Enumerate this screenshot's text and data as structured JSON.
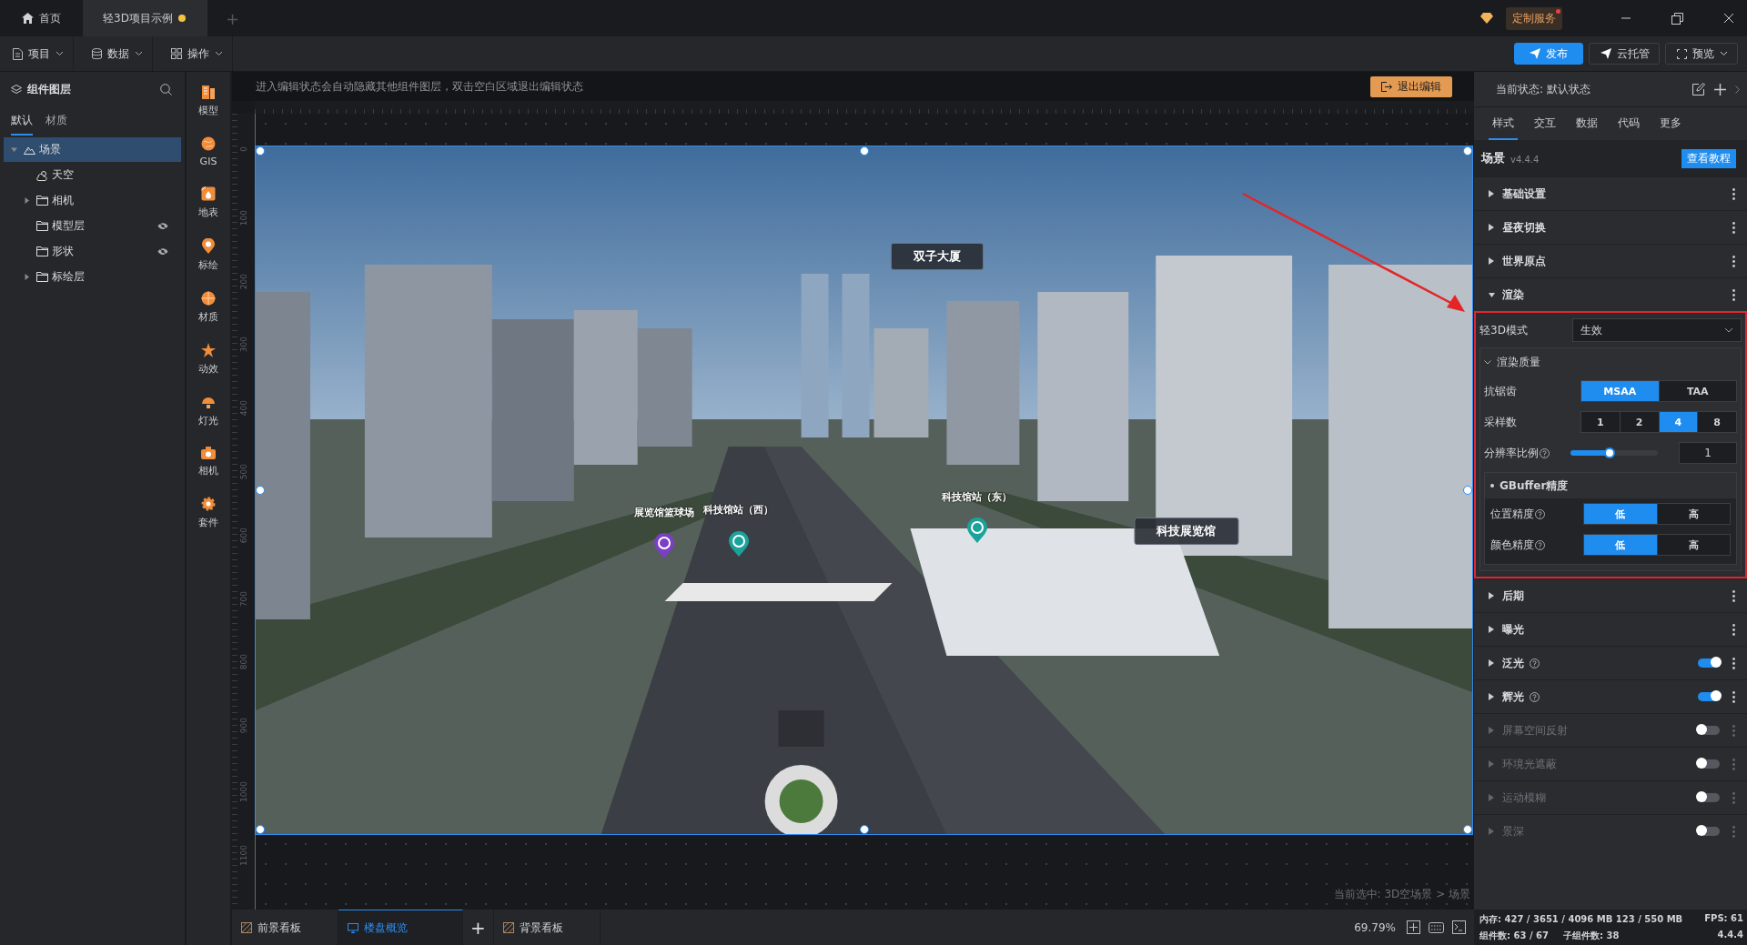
{
  "titlebar": {
    "tabs": [
      {
        "label": "首页",
        "kind": "home",
        "selected": false,
        "unsaved": false
      },
      {
        "label": "轻3D项目示例",
        "kind": "doc",
        "selected": true,
        "unsaved": true
      }
    ],
    "add_tab": "+",
    "service": {
      "label": "定制服务",
      "notification": true
    }
  },
  "toolbar": {
    "menus": [
      {
        "label": "项目",
        "kind": "file"
      },
      {
        "label": "数据",
        "kind": "database"
      },
      {
        "label": "操作",
        "kind": "grid"
      }
    ],
    "actions": [
      {
        "label": "发布",
        "kind": "primary"
      },
      {
        "label": "云托管",
        "kind": "default"
      },
      {
        "label": "预览",
        "kind": "dropdown"
      }
    ]
  },
  "layers_panel": {
    "title": "组件图层",
    "tabs": [
      {
        "label": "默认",
        "selected": true
      },
      {
        "label": "材质",
        "selected": false
      }
    ],
    "tree": [
      {
        "label": "场景",
        "kind": "scene",
        "expanded": true,
        "selected": true,
        "hidden": false,
        "children": [
          {
            "label": "天空",
            "kind": "sky",
            "selected": false,
            "hidden": false
          },
          {
            "label": "相机",
            "kind": "folder",
            "expanded": false,
            "selected": false,
            "hidden": false
          },
          {
            "label": "模型层",
            "kind": "folder",
            "selected": false,
            "hidden": true
          },
          {
            "label": "形状",
            "kind": "folder",
            "selected": false,
            "hidden": true
          },
          {
            "label": "标绘层",
            "kind": "folder",
            "expanded": false,
            "selected": false,
            "hidden": false
          }
        ]
      }
    ]
  },
  "tools": [
    {
      "label": "模型",
      "kind": "model"
    },
    {
      "label": "GIS",
      "kind": "gis"
    },
    {
      "label": "地表",
      "kind": "ground"
    },
    {
      "label": "标绘",
      "kind": "mark"
    },
    {
      "label": "材质",
      "kind": "material"
    },
    {
      "label": "动效",
      "kind": "effect"
    },
    {
      "label": "灯光",
      "kind": "light"
    },
    {
      "label": "相机",
      "kind": "camera"
    },
    {
      "label": "套件",
      "kind": "kit"
    }
  ],
  "canvas": {
    "hint": "进入编辑状态会自动隐藏其他组件图层，双击空白区域退出编辑状态",
    "exit_button": "退出编辑",
    "ruler_labels": [
      "0",
      "100",
      "200",
      "300",
      "400",
      "500",
      "600",
      "700",
      "800",
      "900",
      "1000",
      "1100"
    ],
    "scene_labels": [
      {
        "text": "双子大厦",
        "kind": "tag"
      },
      {
        "text": "科技展览馆",
        "kind": "tag"
      },
      {
        "text": "展览馆篮球场",
        "kind": "poi",
        "color": "#7b3fc4"
      },
      {
        "text": "科技馆站（西）",
        "kind": "poi",
        "color": "#1aa39a"
      },
      {
        "text": "科技馆站（东）",
        "kind": "poi",
        "color": "#1aa39a"
      }
    ],
    "selection": "当前选中: 3D空场景 > 场景"
  },
  "bottom_bar": {
    "boards": [
      {
        "label": "前景看板",
        "kind": "layer",
        "selected": false
      },
      {
        "label": "楼盘概览",
        "kind": "screen",
        "selected": true
      },
      {
        "label": "+",
        "kind": "add"
      },
      {
        "label": "背景看板",
        "kind": "layer",
        "selected": false
      }
    ],
    "zoom": "69.79%"
  },
  "status": {
    "memory": "内存:  427 / 3651 / 4096 MB  123 / 550 MB",
    "fps": "FPS:  61",
    "components": "组件数: 63 / 67",
    "subcomponents": "子组件数: 38",
    "version": "4.4.4"
  },
  "props_panel": {
    "state": "当前状态:  默认状态",
    "tabs": [
      {
        "label": "样式",
        "selected": true
      },
      {
        "label": "交互",
        "selected": false
      },
      {
        "label": "数据",
        "selected": false
      },
      {
        "label": "代码",
        "selected": false
      },
      {
        "label": "更多",
        "selected": false
      }
    ],
    "component": "场景",
    "version": "v4.4.4",
    "tutorial_button": "查看教程",
    "sections": [
      {
        "title": "基础设置",
        "expanded": false
      },
      {
        "title": "昼夜切换",
        "expanded": false
      },
      {
        "title": "世界原点",
        "expanded": false
      },
      {
        "title": "渲染",
        "expanded": true,
        "body": {
          "mode": {
            "label": "轻3D模式",
            "value": "生效"
          },
          "quality": {
            "title": "渲染质量",
            "expanded": true,
            "antialias": {
              "label": "抗锯齿",
              "options": [
                {
                  "label": "MSAA",
                  "selected": true
                },
                {
                  "label": "TAA",
                  "selected": false
                }
              ]
            },
            "samples": {
              "label": "采样数",
              "options": [
                {
                  "label": "1",
                  "selected": false
                },
                {
                  "label": "2",
                  "selected": false
                },
                {
                  "label": "4",
                  "selected": true
                },
                {
                  "label": "8",
                  "selected": false
                }
              ]
            },
            "resolution": {
              "label": "分辨率比例",
              "level": 0.45,
              "value": "1"
            },
            "gbuffer": {
              "title": "GBuffer精度",
              "rows": [
                {
                  "label": "位置精度",
                  "options": [
                    {
                      "label": "低",
                      "selected": true
                    },
                    {
                      "label": "高",
                      "selected": false
                    }
                  ]
                },
                {
                  "label": "颜色精度",
                  "options": [
                    {
                      "label": "低",
                      "selected": true
                    },
                    {
                      "label": "高",
                      "selected": false
                    }
                  ]
                }
              ]
            }
          }
        }
      },
      {
        "title": "后期",
        "expanded": false
      },
      {
        "title": "曝光",
        "expanded": false
      },
      {
        "title": "泛光",
        "expanded": false,
        "help": true,
        "on": true
      },
      {
        "title": "辉光",
        "expanded": false,
        "help": true,
        "on": true
      },
      {
        "title": "屏幕空间反射",
        "expanded": false,
        "on": false
      },
      {
        "title": "环境光遮蔽",
        "expanded": false,
        "on": false
      },
      {
        "title": "运动模糊",
        "expanded": false,
        "on": false
      },
      {
        "title": "景深",
        "expanded": false,
        "on": false
      }
    ]
  }
}
